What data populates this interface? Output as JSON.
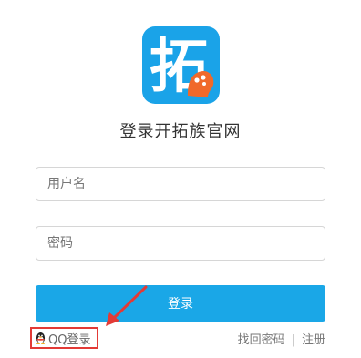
{
  "logo": {
    "icon": "tuozu-logo-icon",
    "glyph": "拓",
    "background": "#1aa3e8",
    "badge_color": "#f0692a"
  },
  "title": "登录开拓族官网",
  "username": {
    "placeholder": "用户名",
    "value": ""
  },
  "password": {
    "placeholder": "密码",
    "value": ""
  },
  "login_button": {
    "label": "登录",
    "color": "#1aa7e7"
  },
  "qq_login": {
    "label": "QQ登录",
    "icon": "qq-penguin-icon",
    "highlight_color": "#e33a36"
  },
  "footer": {
    "forgot_password": "找回密码",
    "separator": "|",
    "register": "注册"
  },
  "annotation": {
    "icon": "red-arrow-icon",
    "color": "#e33a36"
  }
}
